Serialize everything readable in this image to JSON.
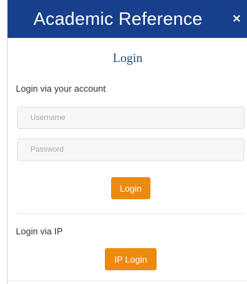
{
  "header": {
    "title": "Academic Reference",
    "close_symbol": "×",
    "close_icon": "close-icon",
    "background_color": "#173f8c"
  },
  "login": {
    "heading": "Login",
    "account_label": "Login via your account",
    "username_placeholder": "Username",
    "username_value": "",
    "password_placeholder": "Password",
    "password_value": "",
    "login_button": "Login",
    "ip_label": "Login via IP",
    "ip_button": "IP Login",
    "button_color": "#ec8a10"
  }
}
